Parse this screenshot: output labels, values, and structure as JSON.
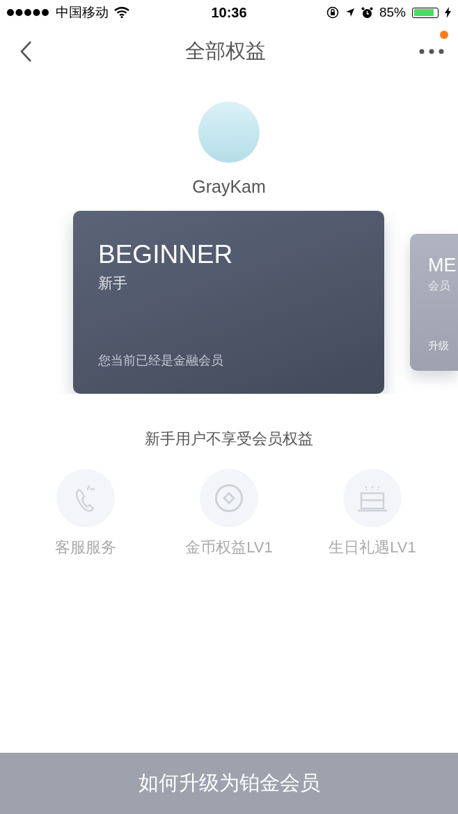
{
  "status_bar": {
    "carrier": "中国移动",
    "time": "10:36",
    "battery_text": "85%",
    "battery": {
      "level": 0.85,
      "charging": true
    }
  },
  "nav": {
    "title": "全部权益",
    "has_notification": true
  },
  "profile": {
    "name": "GrayKam"
  },
  "cards": [
    {
      "title": "BEGINNER",
      "subtitle": "新手",
      "note": "您当前已经是金融会员",
      "selected": true
    },
    {
      "title": "ME",
      "subtitle": "会员",
      "note": "升级",
      "selected": false
    }
  ],
  "notice": "新手用户不享受会员权益",
  "benefits": [
    {
      "kind": "phone",
      "label": "客服服务"
    },
    {
      "kind": "coin",
      "label": "金币权益LV1"
    },
    {
      "kind": "cake",
      "label": "生日礼遇LV1"
    }
  ],
  "bottom_button": "如何升级为铂金会员"
}
